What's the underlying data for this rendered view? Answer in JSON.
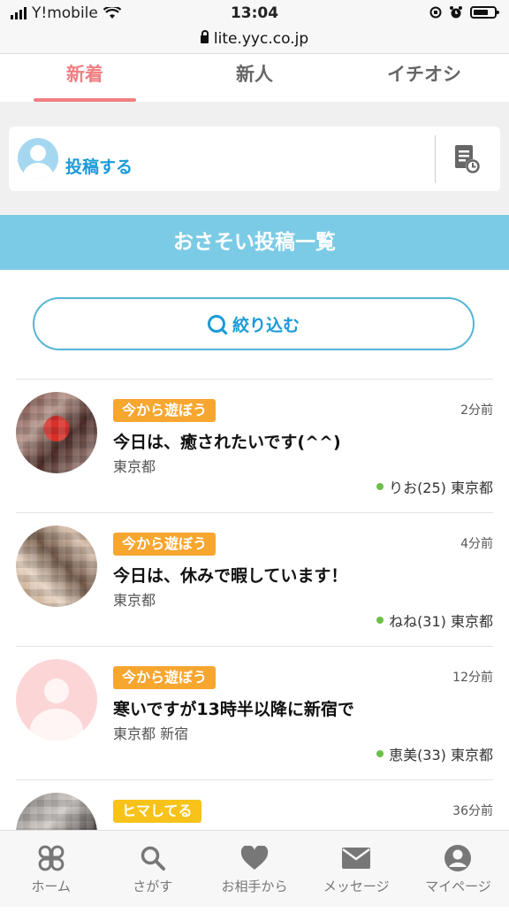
{
  "status_bar": {
    "carrier": "Y!mobile",
    "time": "13:04"
  },
  "url_bar": {
    "url": "lite.yyc.co.jp"
  },
  "tabs": [
    {
      "label": "新着",
      "active": true
    },
    {
      "label": "新人",
      "active": false
    },
    {
      "label": "イチオシ",
      "active": false
    }
  ],
  "post_button": {
    "label": "投稿する"
  },
  "banner": {
    "title": "おさそい投稿一覧"
  },
  "filter": {
    "label": "絞り込む"
  },
  "posts": [
    {
      "tag": "今から遊ぼう",
      "tag_color": "#f7a630",
      "time": "2分前",
      "title": "今日は、癒されたいです(^^)",
      "area": "東京都",
      "user": "りお(25) 東京都"
    },
    {
      "tag": "今から遊ぼう",
      "tag_color": "#f7a630",
      "time": "4分前",
      "title": "今日は、休みで暇しています！",
      "area": "東京都",
      "user": "ねね(31) 東京都"
    },
    {
      "tag": "今から遊ぼう",
      "tag_color": "#f7a630",
      "time": "12分前",
      "title": "寒いですが13時半以降に新宿で",
      "area": "東京都 新宿",
      "user": "恵美(33) 東京都"
    },
    {
      "tag": "ヒマしてる",
      "tag_color": "#f7c31a",
      "time": "36分前"
    }
  ],
  "bottom_nav": [
    {
      "label": "ホーム",
      "icon": "clover-icon"
    },
    {
      "label": "さがす",
      "icon": "search-icon"
    },
    {
      "label": "お相手から",
      "icon": "heart-icon"
    },
    {
      "label": "メッセージ",
      "icon": "mail-icon"
    },
    {
      "label": "マイページ",
      "icon": "user-circle-icon"
    }
  ],
  "colors": {
    "accent_pink": "#f07f83",
    "accent_blue": "#1a9bd7",
    "banner": "#7ccbe6",
    "online": "#6cc04a"
  }
}
